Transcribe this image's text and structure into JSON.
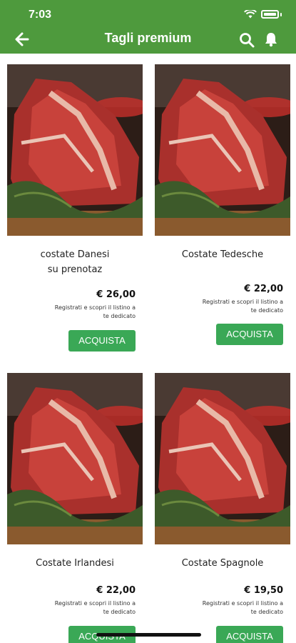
{
  "status": {
    "time": "7:03"
  },
  "header": {
    "title": "Tagli premium"
  },
  "colors": {
    "brand_green": "#4e9a3d",
    "button_green": "#3aa856"
  },
  "icons": {
    "back": "arrow-left-icon",
    "search": "search-icon",
    "notifications": "bell-icon"
  },
  "products": [
    {
      "name_line1": "costate Danesi",
      "name_line2": "su prenotaz",
      "price": "€ 26,00",
      "note_line1": "Registrati e scopri il listino a",
      "note_line2": "te dedicato",
      "button": "ACQUISTA"
    },
    {
      "name_line1": "Costate Tedesche",
      "name_line2": "",
      "price": "€ 22,00",
      "note_line1": "Registrati e scopri il listino a",
      "note_line2": "te dedicato",
      "button": "ACQUISTA"
    },
    {
      "name_line1": "Costate Irlandesi",
      "name_line2": "",
      "price": "€ 22,00",
      "note_line1": "Registrati e scopri il listino a",
      "note_line2": "te dedicato",
      "button": "ACQUISTA"
    },
    {
      "name_line1": "Costate Spagnole",
      "name_line2": "",
      "price": "€ 19,50",
      "note_line1": "Registrati e scopri il listino a",
      "note_line2": "te dedicato",
      "button": "ACQUISTA"
    }
  ]
}
